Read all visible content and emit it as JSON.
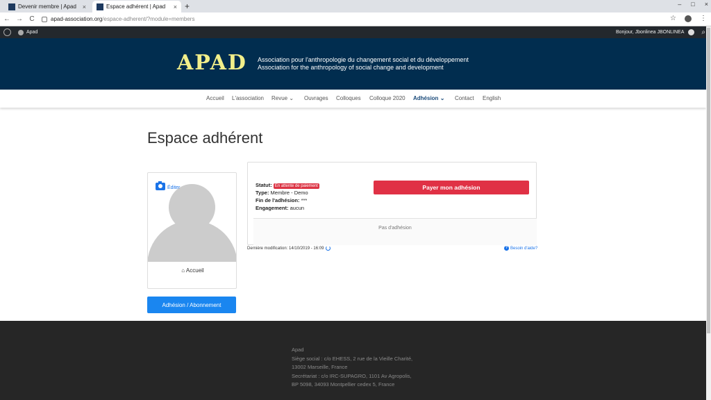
{
  "browser": {
    "tabs": [
      {
        "title": "Devenir membre | Apad",
        "close": "×"
      },
      {
        "title": "Espace adhérent | Apad",
        "close": "×"
      }
    ],
    "new_tab": "+",
    "nav": {
      "back": "←",
      "forward": "→",
      "reload": "C"
    },
    "url_host": "apad-association.org",
    "url_path": "/espace-adherent/?module=members",
    "star": "☆",
    "menu": "⋮",
    "window_controls": {
      "minimize": "–",
      "maximize": "□",
      "close": "×"
    }
  },
  "wp_admin_bar": {
    "site_name": "Apad",
    "greeting": "Bonjour, Jbonlinea JBONLINEA",
    "search_icon": "⌕"
  },
  "site": {
    "logo": "APAD",
    "tagline_fr": "Association pour l'anthropologie du changement social et du développement",
    "tagline_en": "Association for the anthropology of social change and development"
  },
  "nav": {
    "items": [
      {
        "label": "Accueil"
      },
      {
        "label": "L'association"
      },
      {
        "label": "Revue",
        "caret": "⌄"
      },
      {
        "label": "Ouvrages"
      },
      {
        "label": "Colloques"
      },
      {
        "label": "Colloque 2020"
      },
      {
        "label": "Adhésion",
        "caret": "⌄",
        "active": true
      },
      {
        "label": "Contact"
      },
      {
        "label": "English"
      }
    ]
  },
  "main": {
    "page_title": "Espace adhérent",
    "profile": {
      "edit_label": "Éditer",
      "home_icon": "⌂",
      "home_label": "Accueil"
    },
    "membership_button": "Adhésion / Abonnement",
    "status": {
      "statut_label": "Statut:",
      "statut_badge": "En attente de paiement",
      "type_label": "Type:",
      "type_value": "Membre - Demo",
      "fin_label": "Fin de l'adhésion:",
      "fin_value": "***",
      "engagement_label": "Engagement:",
      "engagement_value": "aucun",
      "pay_button": "Payer mon adhésion",
      "no_membership": "Pas d'adhésion"
    },
    "last_modified": "Dernière modification: 14/10/2019 - 16:09",
    "help_icon": "?",
    "help_link": "Besoin d'aide?"
  },
  "footer": {
    "lines": [
      "Apad",
      "Siège social : c/o EHESS, 2 rue de la Vieille Charité,",
      "13002 Marseille, France",
      "Secrétariat : c/o IRC-SUPAGRO, 1101 Av Agropolis,",
      "BP 5098, 34093 Montpellier cedex 5, France"
    ]
  },
  "colors": {
    "header_bg": "#012d4f",
    "logo": "#f2ef8a",
    "pay_button": "#e03145",
    "badge": "#dc3545",
    "primary_button": "#1a86f0",
    "footer_bg": "#262626"
  }
}
